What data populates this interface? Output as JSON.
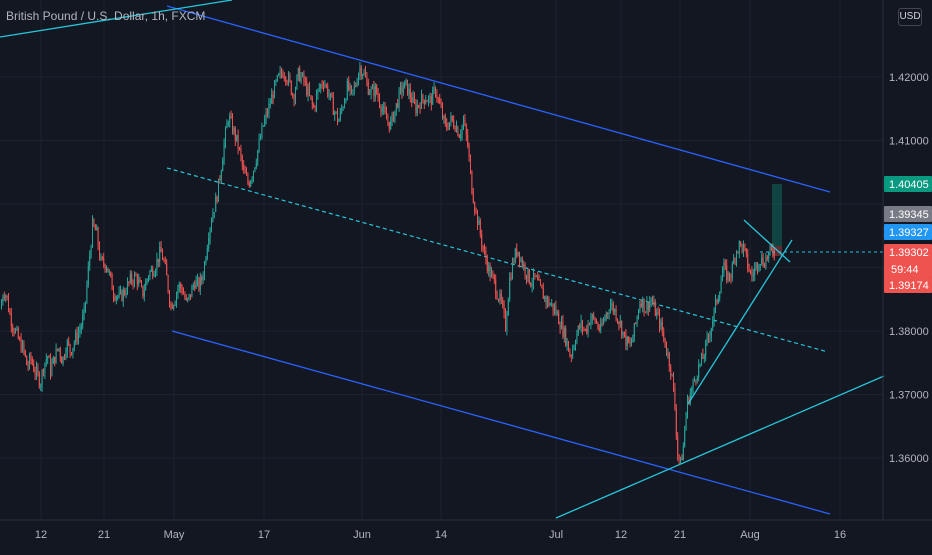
{
  "header": {
    "symbol_title": "British Pound / U.S. Dollar, 1h, FXCM",
    "currency_button": "USD"
  },
  "colors": {
    "background": "#131722",
    "up": "#26a69a",
    "down": "#ef5350",
    "grid": "#1e222d",
    "axis_text": "#b2b5be",
    "channel": "#2962ff",
    "trend": "#26c6da",
    "price_tag": "#ef5350",
    "target_tag": "#089981",
    "mid_tag": "#2196f3",
    "gray_tag": "#787b86"
  },
  "chart_data": {
    "type": "candlestick",
    "title": "British Pound / U.S. Dollar, 1h, FXCM",
    "currency": "USD",
    "y_axis": {
      "position": "right",
      "ticks": [
        1.36,
        1.37,
        1.38,
        1.39,
        1.4,
        1.41,
        1.42
      ],
      "tick_labels": [
        "1.36000",
        "1.37000",
        "1.38000",
        "",
        "",
        "1.41000",
        "1.42000"
      ],
      "range": [
        1.3525,
        1.4315
      ]
    },
    "x_axis": {
      "tick_labels": [
        "12",
        "21",
        "May",
        "17",
        "Jun",
        "14",
        "Jul",
        "12",
        "21",
        "Aug",
        "16"
      ]
    },
    "series": [
      {
        "name": "close-path",
        "x": [
          0,
          3,
          6,
          9,
          12,
          16,
          19,
          23,
          27,
          30,
          34,
          37,
          40,
          43,
          47,
          50,
          54,
          58,
          62,
          66,
          70,
          75,
          80,
          84,
          88,
          92,
          96,
          100,
          106,
          113,
          119,
          124,
          130,
          136,
          142,
          148,
          154,
          160,
          163,
          166,
          170,
          174,
          178,
          182,
          186,
          190,
          194,
          198,
          201,
          204,
          208,
          212,
          216,
          220,
          224,
          228,
          233,
          238,
          243,
          248,
          253,
          258,
          263,
          268,
          273,
          278,
          283,
          288,
          293,
          298,
          303,
          308,
          313,
          318,
          323,
          328,
          333,
          338,
          343,
          347,
          351,
          355,
          359,
          363,
          367,
          371,
          375,
          380,
          385,
          390,
          395,
          400,
          405,
          410,
          415,
          420,
          425,
          430,
          435,
          440,
          445,
          450,
          455,
          459,
          463,
          467,
          471,
          475,
          479,
          483,
          486,
          489,
          493,
          497,
          501,
          505,
          509,
          513,
          517,
          521,
          525,
          530,
          535,
          540,
          545,
          550,
          555,
          560,
          565,
          570,
          575,
          580,
          585,
          590,
          595,
          600,
          605,
          610,
          615,
          620,
          625,
          630,
          635,
          640,
          645,
          650,
          655,
          659,
          663,
          667,
          671,
          674,
          677,
          680,
          683,
          686,
          689,
          692,
          695,
          699,
          703,
          707,
          711,
          715,
          719,
          723,
          727,
          731,
          735,
          739,
          743,
          747,
          751,
          755,
          759,
          763,
          767,
          771,
          775,
          779
        ],
        "close": [
          1.3835,
          1.3865,
          1.3855,
          1.3828,
          1.381,
          1.3795,
          1.3782,
          1.377,
          1.3742,
          1.3758,
          1.3738,
          1.373,
          1.3718,
          1.3745,
          1.3762,
          1.3738,
          1.3758,
          1.3775,
          1.3752,
          1.3782,
          1.3768,
          1.3788,
          1.3805,
          1.383,
          1.39,
          1.3965,
          1.3955,
          1.3908,
          1.3905,
          1.3862,
          1.3852,
          1.3862,
          1.388,
          1.3885,
          1.3858,
          1.389,
          1.39,
          1.3925,
          1.3912,
          1.3886,
          1.384,
          1.385,
          1.3872,
          1.3865,
          1.3842,
          1.3858,
          1.3878,
          1.387,
          1.388,
          1.3905,
          1.3955,
          1.3985,
          1.4008,
          1.405,
          1.41,
          1.4138,
          1.4115,
          1.409,
          1.405,
          1.4032,
          1.4055,
          1.409,
          1.4125,
          1.415,
          1.4178,
          1.4198,
          1.421,
          1.4195,
          1.417,
          1.4205,
          1.4195,
          1.4172,
          1.415,
          1.418,
          1.4195,
          1.4175,
          1.415,
          1.413,
          1.416,
          1.4185,
          1.417,
          1.4188,
          1.4215,
          1.4208,
          1.4185,
          1.4175,
          1.418,
          1.4158,
          1.4135,
          1.4125,
          1.415,
          1.4178,
          1.4188,
          1.417,
          1.415,
          1.4162,
          1.4168,
          1.4162,
          1.418,
          1.415,
          1.412,
          1.4132,
          1.4125,
          1.411,
          1.413,
          1.4095,
          1.403,
          1.399,
          1.396,
          1.3925,
          1.391,
          1.3892,
          1.388,
          1.3858,
          1.3842,
          1.3808,
          1.388,
          1.3912,
          1.393,
          1.391,
          1.3895,
          1.3878,
          1.3882,
          1.3865,
          1.385,
          1.3842,
          1.3832,
          1.3812,
          1.379,
          1.376,
          1.379,
          1.381,
          1.38,
          1.3822,
          1.3815,
          1.38,
          1.3825,
          1.3842,
          1.383,
          1.381,
          1.3785,
          1.3775,
          1.381,
          1.3852,
          1.3835,
          1.385,
          1.383,
          1.3815,
          1.379,
          1.3765,
          1.3735,
          1.369,
          1.361,
          1.359,
          1.362,
          1.368,
          1.37,
          1.371,
          1.373,
          1.3745,
          1.376,
          1.3785,
          1.381,
          1.384,
          1.3868,
          1.39,
          1.3885,
          1.3892,
          1.3925,
          1.3935,
          1.393,
          1.3905,
          1.3885,
          1.39,
          1.3915,
          1.3908,
          1.3918,
          1.3925,
          1.393
        ]
      }
    ],
    "price_labels": [
      {
        "value": "1.40405",
        "price": 1.40405,
        "color": "#089981"
      },
      {
        "value": "1.39345",
        "price": 1.39345,
        "color": "#787b86"
      },
      {
        "value": "1.39327",
        "price": 1.39327,
        "color": "#2196f3"
      },
      {
        "value": "1.39302",
        "price": 1.39302,
        "color": "#ef5350",
        "countdown": "59:44"
      },
      {
        "value": "1.39174",
        "price": 1.39174,
        "color": "#ef5350"
      }
    ],
    "annotations": [
      {
        "kind": "channel-line",
        "name": "upper-channel"
      },
      {
        "kind": "channel-line",
        "name": "lower-channel"
      },
      {
        "kind": "dashed-midline",
        "name": "channel-midline"
      },
      {
        "kind": "trendline",
        "name": "long-uptrend"
      },
      {
        "kind": "wedge",
        "name": "rising-wedge"
      },
      {
        "kind": "position-box",
        "name": "long-target-box",
        "target": 1.40405,
        "entry": 1.39327,
        "stop": 1.39174
      }
    ]
  }
}
